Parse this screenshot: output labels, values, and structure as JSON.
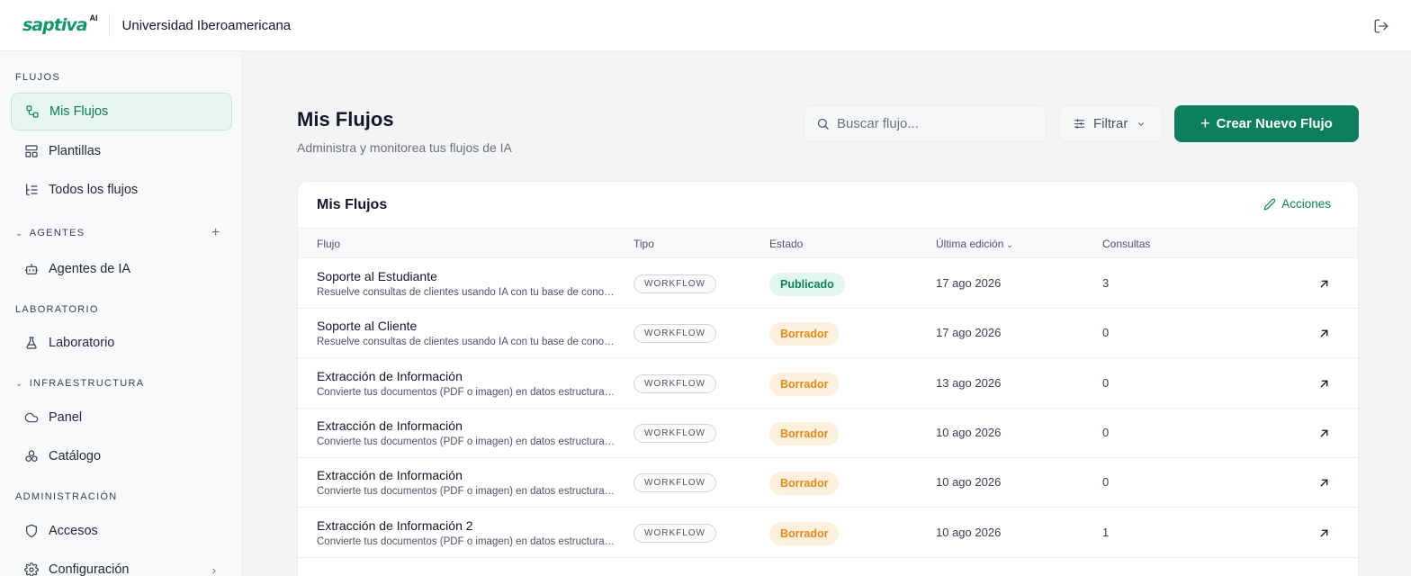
{
  "brand": {
    "logo_text": "saptiva",
    "logo_suffix": "AI",
    "org_name": "Universidad Iberoamericana"
  },
  "sidebar": {
    "sections": {
      "flujos": "FLUJOS",
      "agentes": "AGENTES",
      "laboratorio": "LABORATORIO",
      "infraestructura": "INFRAESTRUCTURA",
      "administracion": "ADMINISTRACIÓN"
    },
    "items": {
      "mis_flujos": "Mis Flujos",
      "plantillas": "Plantillas",
      "todos_flujos": "Todos los flujos",
      "agentes_ia": "Agentes de IA",
      "laboratorio": "Laboratorio",
      "panel": "Panel",
      "catalogo": "Catálogo",
      "accesos": "Accesos",
      "configuracion": "Configuración"
    },
    "add_symbol": "+",
    "active_item": "mis_flujos"
  },
  "header": {
    "title": "Mis Flujos",
    "subtitle": "Administra y monitorea tus flujos de IA",
    "search_placeholder": "Buscar flujo...",
    "filter_label": "Filtrar",
    "create_label": "Crear Nuevo Flujo"
  },
  "table": {
    "title": "Mis Flujos",
    "actions_label": "Acciones",
    "columns": {
      "flujo": "Flujo",
      "tipo": "Tipo",
      "estado": "Estado",
      "edicion": "Última edición",
      "consultas": "Consultas"
    },
    "rows": [
      {
        "name": "Soporte al Estudiante",
        "desc": "Resuelve consultas de clientes usando IA con tu base de conocimiento",
        "type": "WORKFLOW",
        "status": "Publicado",
        "status_kind": "published",
        "date": "17 ago 2026",
        "count": "3"
      },
      {
        "name": "Soporte al Cliente",
        "desc": "Resuelve consultas de clientes usando IA con tu base de conocimiento",
        "type": "WORKFLOW",
        "status": "Borrador",
        "status_kind": "draft",
        "date": "17 ago 2026",
        "count": "0"
      },
      {
        "name": "Extracción de Información",
        "desc": "Convierte tus documentos (PDF o imagen) en datos estructurados",
        "type": "WORKFLOW",
        "status": "Borrador",
        "status_kind": "draft",
        "date": "13 ago 2026",
        "count": "0"
      },
      {
        "name": "Extracción de Información",
        "desc": "Convierte tus documentos (PDF o imagen) en datos estructurados",
        "type": "WORKFLOW",
        "status": "Borrador",
        "status_kind": "draft",
        "date": "10 ago 2026",
        "count": "0"
      },
      {
        "name": "Extracción de Información",
        "desc": "Convierte tus documentos (PDF o imagen) en datos estructurados",
        "type": "WORKFLOW",
        "status": "Borrador",
        "status_kind": "draft",
        "date": "10 ago 2026",
        "count": "0"
      },
      {
        "name": "Extracción de Información 2",
        "desc": "Convierte tus documentos (PDF o imagen) en datos estructurados",
        "type": "WORKFLOW",
        "status": "Borrador",
        "status_kind": "draft",
        "date": "10 ago 2026",
        "count": "1"
      }
    ]
  },
  "colors": {
    "accent": "#0e7f5c",
    "published_bg": "#e3f6ee",
    "draft_bg": "#fdf0dd",
    "draft_text": "#e48a1a"
  }
}
